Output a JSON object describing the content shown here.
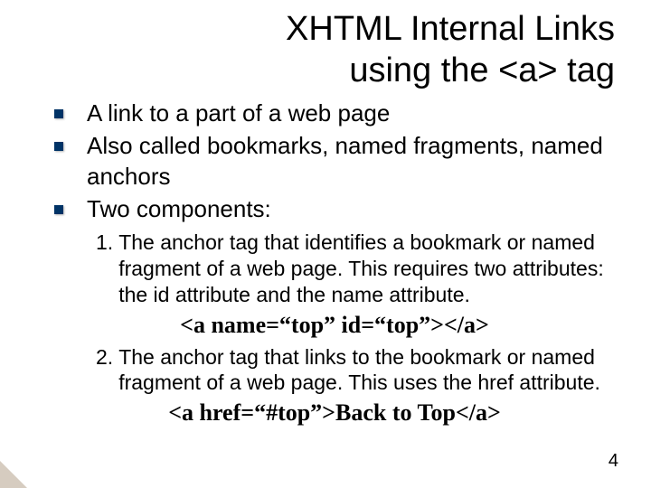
{
  "title_line1": "XHTML Internal Links",
  "title_line2": "using the <a> tag",
  "bullets": [
    "A link to a part of a web page",
    "Also called bookmarks, named fragments, named anchors",
    "Two components:"
  ],
  "numbered": [
    {
      "num": "1.",
      "text": "The anchor tag that identifies a bookmark or named fragment of a web page. This requires two attributes: the id attribute and the name attribute."
    },
    {
      "num": "2.",
      "text": "The anchor tag that links to the bookmark or named fragment of a web page. This uses the href attribute."
    }
  ],
  "code1": "<a name=“top” id=“top”></a>",
  "code2": "<a href=“#top”>Back to Top</a>",
  "page_number": "4"
}
